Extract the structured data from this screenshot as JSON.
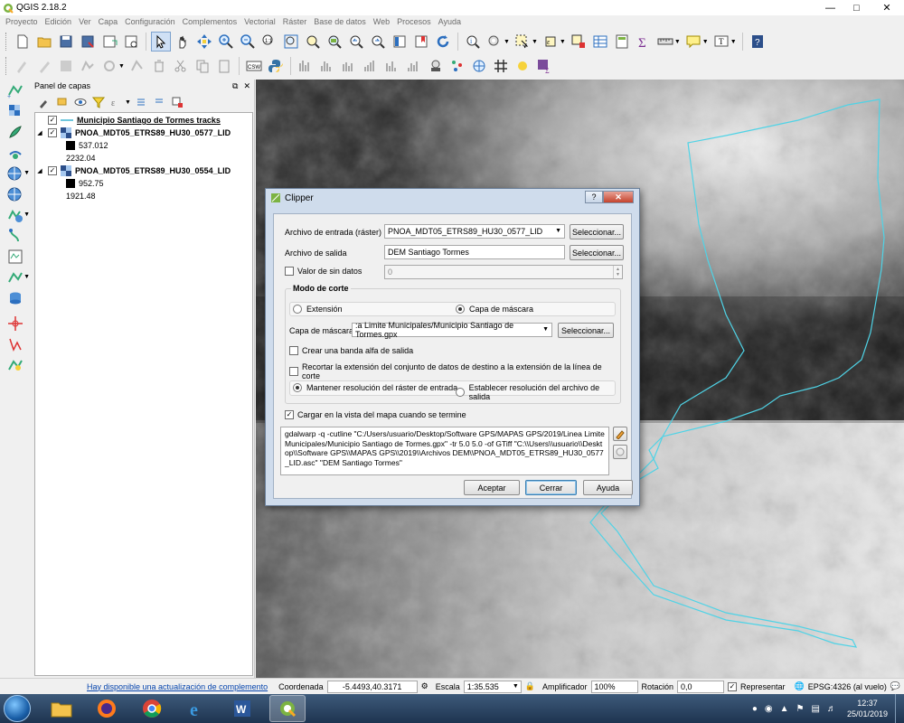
{
  "window": {
    "title": "QGIS 2.18.2"
  },
  "menu": [
    "Proyecto",
    "Edición",
    "Ver",
    "Capa",
    "Configuración",
    "Complementos",
    "Vectorial",
    "Ráster",
    "Base de datos",
    "Web",
    "Procesos",
    "Ayuda"
  ],
  "layers_panel": {
    "title": "Panel de capas",
    "layers": [
      {
        "name": "Municipio Santiago de Tormes tracks",
        "checked": true
      },
      {
        "name": "PNOA_MDT05_ETRS89_HU30_0577_LID",
        "checked": true,
        "legend_min": "537.012",
        "legend_max": "2232.04"
      },
      {
        "name": "PNOA_MDT05_ETRS89_HU30_0554_LID",
        "checked": true,
        "legend_min": "952.75",
        "legend_max": "1921.48"
      }
    ]
  },
  "dialog": {
    "title": "Clipper",
    "help_btn": "?",
    "close_btn": "✕",
    "input_label": "Archivo de entrada (ráster)",
    "input_value": "PNOA_MDT05_ETRS89_HU30_0577_LID",
    "select_btn": "Seleccionar...",
    "output_label": "Archivo de salida",
    "output_value": "DEM Santiago Tormes",
    "nodata_label": "Valor de sin datos",
    "nodata_value": "0",
    "mode_title": "Modo de corte",
    "mode_extent": "Extensión",
    "mode_mask": "Capa de máscara",
    "mask_label": "Capa de máscara",
    "mask_value": ":a Limite Municipales/Municipio Santiago de Tormes.gpx",
    "alpha_label": "Crear una banda alfa de salida",
    "crop_label": "Recortar la extensión del conjunto de datos de destino a la extensión de la línea de corte",
    "keep_res_label": "Mantener resolución del ráster de entrada",
    "set_res_label": "Establecer resolución del archivo de salida",
    "load_label": "Cargar en la vista del mapa cuando se termine",
    "command": "gdalwarp -q -cutline \"C:/Users/usuario/Desktop/Software GPS/MAPAS GPS/2019/Linea Limite Municipales/Municipio Santiago de Tormes.gpx\" -tr 5.0 5.0 -of GTiff \"C:\\\\Users\\\\usuario\\\\Desktop\\\\Software GPS\\\\MAPAS GPS\\\\2019\\\\Archivos DEM\\\\PNOA_MDT05_ETRS89_HU30_0577_LID.asc\" \"DEM Santiago Tormes\"",
    "accept_btn": "Aceptar",
    "close_btn_label": "Cerrar",
    "help_btn_label": "Ayuda"
  },
  "status": {
    "update_link": "Hay disponible una actualización de complemento",
    "coord_label": "Coordenada",
    "coord_value": "-5.4493,40.3171",
    "scale_label": "Escala",
    "scale_value": "1:35.535",
    "magnifier_label": "Amplificador",
    "magnifier_value": "100%",
    "rotation_label": "Rotación",
    "rotation_value": "0,0",
    "render_label": "Representar",
    "crs_label": "EPSG:4326 (al vuelo)"
  },
  "taskbar": {
    "time": "12:37",
    "date": "25/01/2019"
  }
}
